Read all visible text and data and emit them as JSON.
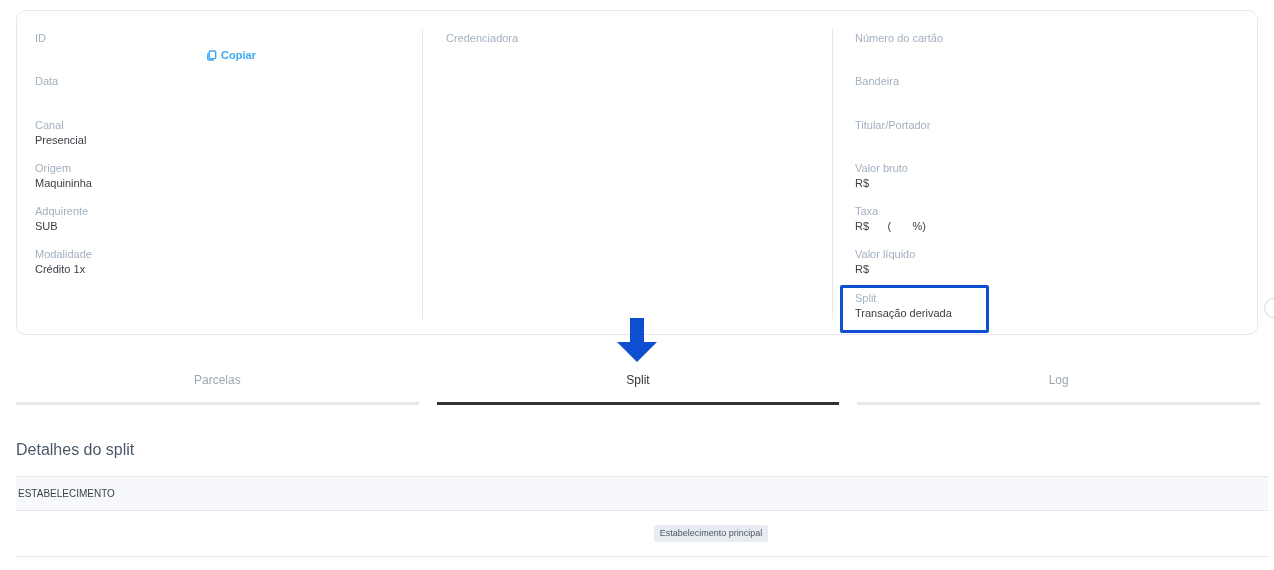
{
  "details": {
    "columns": [
      {
        "fields": [
          {
            "label": "ID",
            "copy_button": "Copiar",
            "highlighted": false
          },
          {
            "label": "Data",
            "highlighted": false
          },
          {
            "label": "Canal",
            "value": "Presencial",
            "highlighted": false
          },
          {
            "label": "Origem",
            "value": "Maquininha",
            "highlighted": false
          },
          {
            "label": "Adquirente",
            "value": "SUB",
            "highlighted": false
          },
          {
            "label": "Modalidade",
            "value": "Crédito 1x",
            "highlighted": false
          }
        ]
      },
      {
        "fields": [
          {
            "label": "Credenciadora",
            "highlighted": false
          }
        ]
      },
      {
        "fields": [
          {
            "label": "Número do cartão",
            "highlighted": false
          },
          {
            "label": "Bandeira",
            "highlighted": false
          },
          {
            "label": "Titular/Portador",
            "highlighted": false
          },
          {
            "label": "Valor bruto",
            "value": "R$",
            "highlighted": false
          },
          {
            "label": "Taxa",
            "value": "R$      (       %)",
            "highlighted": false
          },
          {
            "label": "Valor líquido",
            "value": "R$",
            "highlighted": false
          },
          {
            "label": "Split",
            "value": "Transação derivada",
            "highlighted": true
          }
        ]
      }
    ]
  },
  "tabs": [
    {
      "label": "Parcelas",
      "selected": false,
      "marked": false
    },
    {
      "label": "Split",
      "selected": true,
      "marked": true
    },
    {
      "label": "Log",
      "selected": false,
      "marked": false
    }
  ],
  "section_title": "Detalhes do split",
  "table": {
    "columns": [
      "ESTABELECIMENTO"
    ],
    "rows": [
      {
        "badge": "Estabelecimento principal"
      }
    ]
  }
}
